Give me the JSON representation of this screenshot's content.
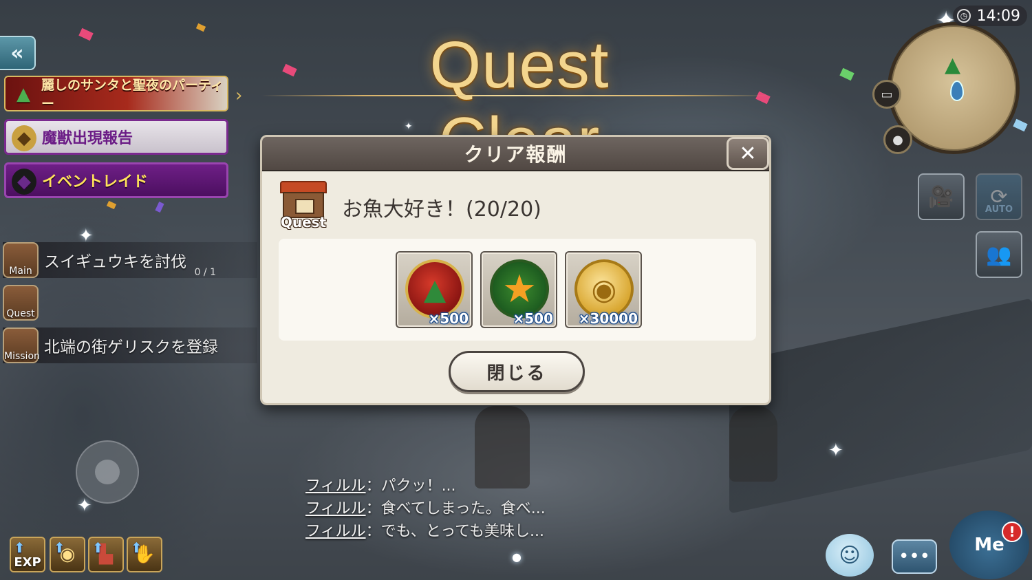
{
  "title": "Quest Clear",
  "clock": "14:09",
  "left_panel": {
    "back_icon": "double-chevron-left",
    "banners": [
      {
        "label": "麗しのサンタと聖夜のパーティー",
        "icon": "christmas-tree"
      },
      {
        "label": "魔獣出現報告",
        "icon": "beast-mask"
      },
      {
        "label": "イベントレイド",
        "icon": "cat-mask"
      }
    ],
    "quests": [
      {
        "badge": "Main",
        "text": "スイギュウキを討伐",
        "count": "0 / 1"
      },
      {
        "badge": "Quest",
        "text": "",
        "count": ""
      },
      {
        "badge": "Mission",
        "text": "北端の街ゲリスクを登録",
        "count": ""
      }
    ],
    "boosts": [
      {
        "label": "EXP",
        "icon": "exp-boost"
      },
      {
        "label": "",
        "icon": "coin-boost"
      },
      {
        "label": "",
        "icon": "boot-boost"
      },
      {
        "label": "",
        "icon": "hand-boost"
      }
    ]
  },
  "chat": [
    {
      "name": "フィルル",
      "text": "：パクッ！..."
    },
    {
      "name": "フィルル",
      "text": "：食べてしまった。食べ..."
    },
    {
      "name": "フィルル",
      "text": "：でも、とっても美味し..."
    }
  ],
  "right_panel": {
    "camera_icon": "camera-icon",
    "auto_label": "AUTO",
    "party_icon": "party-icon",
    "menu_label": "Me",
    "alert": "!"
  },
  "dialog": {
    "header": "クリア報酬",
    "close_symbol": "✕",
    "quest_badge": "Quest",
    "quest_title": "お魚大好き！(20/20)",
    "rewards": [
      {
        "icon": "christmas-tree-medal",
        "qty": "×500"
      },
      {
        "icon": "star-wreath",
        "qty": "×500"
      },
      {
        "icon": "gold-coin",
        "qty": "×30000"
      }
    ],
    "close_button": "閉じる"
  },
  "colors": {
    "title_gold": "#f3d58e",
    "dialog_bg": "#efebe0",
    "header_bg": "#514843",
    "qty_blue": "#2a6aca"
  }
}
